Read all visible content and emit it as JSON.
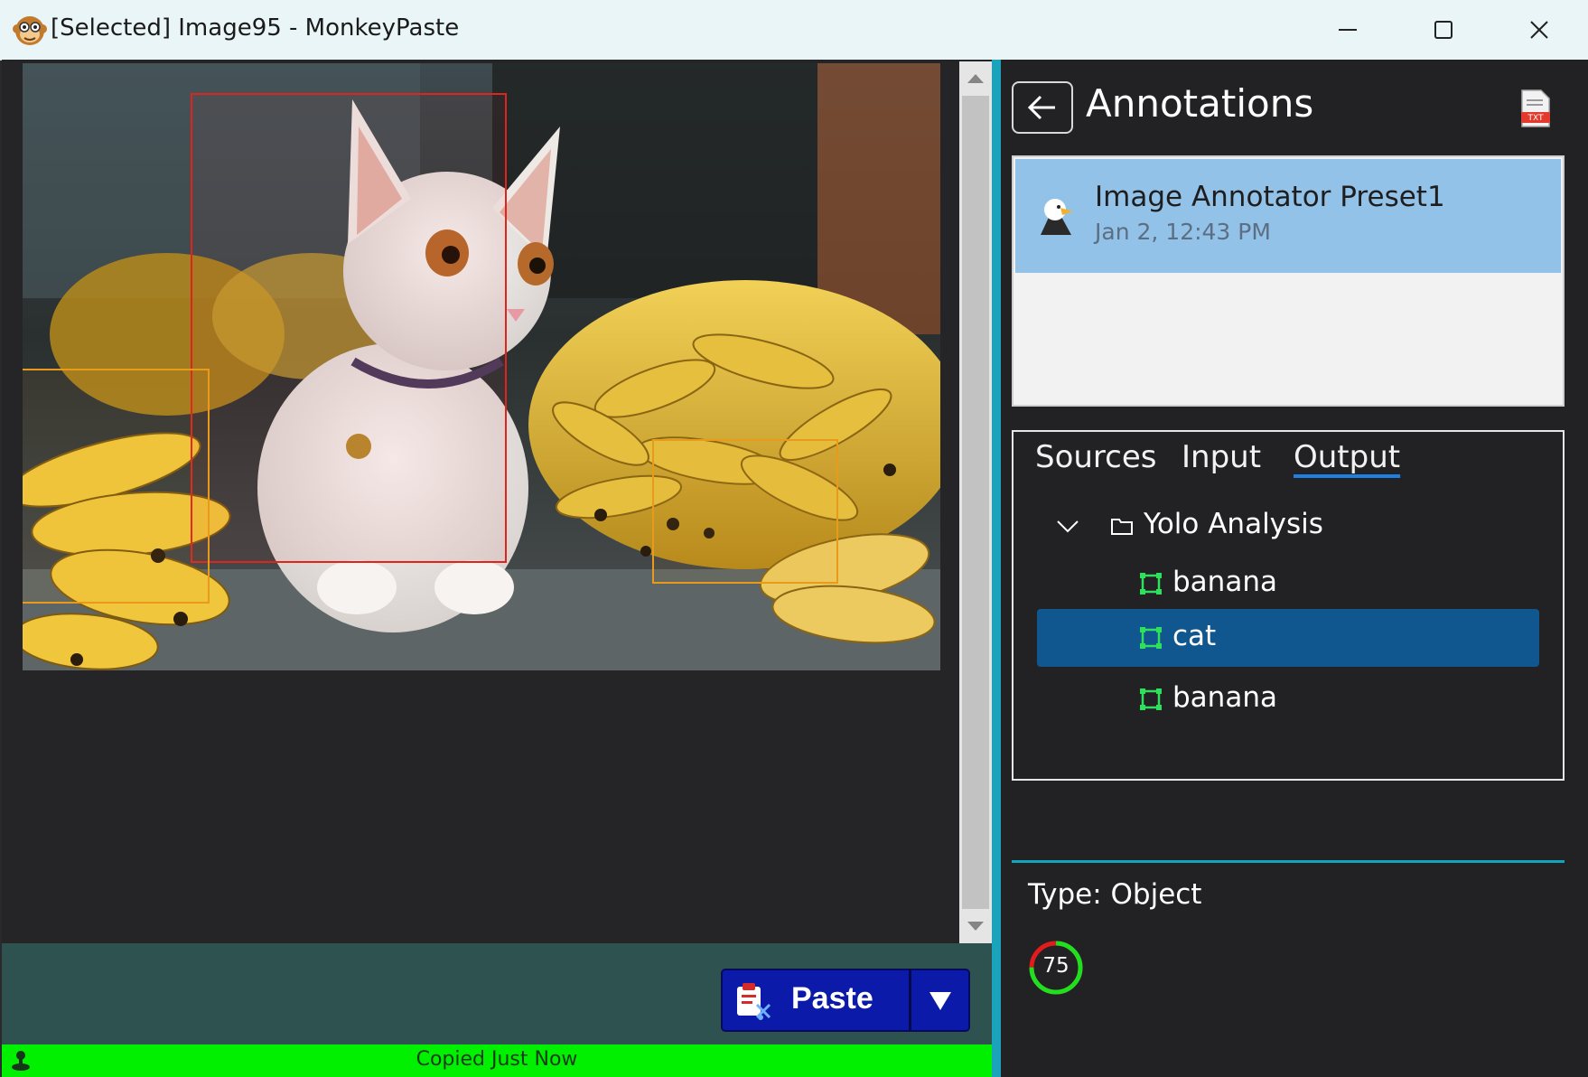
{
  "window": {
    "title": "[Selected] Image95 - MonkeyPaste",
    "app_icon": "monkey-face-icon",
    "controls": [
      "minimize-icon",
      "maximize-icon",
      "close-icon"
    ]
  },
  "content": {
    "image_icon": "photo-cat-bananas",
    "detections": [
      {
        "label": "cat",
        "color": "#e0241c"
      },
      {
        "label": "banana",
        "color": "#e89a1a"
      },
      {
        "label": "banana",
        "color": "#e89a1a"
      }
    ]
  },
  "toolbar": {
    "paste_label": "Paste",
    "paste_icon": "paste-clipboard-icon",
    "dropdown_icon": "triangle-down-icon",
    "button_color": "#0b1aa8"
  },
  "status": {
    "text": "Copied Just Now",
    "icon": "joystick-icon",
    "color": "#00f000"
  },
  "annotations": {
    "title": "Annotations",
    "back_icon": "arrow-left-icon",
    "export_icon": "txt-file-icon",
    "preset": {
      "name": "Image Annotator Preset1",
      "date": "Jan 2, 12:43 PM",
      "icon": "eagle-icon"
    },
    "tabs": [
      "Sources",
      "Input",
      "Output"
    ],
    "active_tab": "Output",
    "tree": {
      "root": "Yolo Analysis",
      "root_icon": "folder-icon",
      "expand_icon": "chevron-down-icon",
      "items": [
        {
          "label": "banana",
          "icon": "bounding-box-icon",
          "selected": false
        },
        {
          "label": "cat",
          "icon": "bounding-box-icon",
          "selected": true
        },
        {
          "label": "banana",
          "icon": "bounding-box-icon",
          "selected": false
        }
      ]
    },
    "type_label": "Type: Object",
    "score": "75",
    "score_value": 0.75,
    "accent_color": "#14a3bd",
    "selection_color": "#11578f"
  }
}
